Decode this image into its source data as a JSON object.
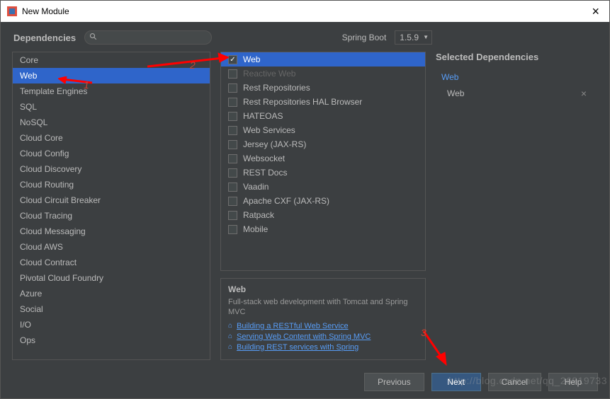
{
  "window": {
    "title": "New Module"
  },
  "header": {
    "dependencies_label": "Dependencies",
    "spring_boot_label": "Spring Boot",
    "version": "1.5.9"
  },
  "categories": [
    "Core",
    "Web",
    "Template Engines",
    "SQL",
    "NoSQL",
    "Cloud Core",
    "Cloud Config",
    "Cloud Discovery",
    "Cloud Routing",
    "Cloud Circuit Breaker",
    "Cloud Tracing",
    "Cloud Messaging",
    "Cloud AWS",
    "Cloud Contract",
    "Pivotal Cloud Foundry",
    "Azure",
    "Social",
    "I/O",
    "Ops"
  ],
  "categories_selected_index": 1,
  "dependencies": [
    {
      "label": "Web",
      "checked": true,
      "selected": true
    },
    {
      "label": "Reactive Web",
      "checked": false,
      "dim": true
    },
    {
      "label": "Rest Repositories",
      "checked": false
    },
    {
      "label": "Rest Repositories HAL Browser",
      "checked": false
    },
    {
      "label": "HATEOAS",
      "checked": false
    },
    {
      "label": "Web Services",
      "checked": false
    },
    {
      "label": "Jersey (JAX-RS)",
      "checked": false
    },
    {
      "label": "Websocket",
      "checked": false
    },
    {
      "label": "REST Docs",
      "checked": false
    },
    {
      "label": "Vaadin",
      "checked": false
    },
    {
      "label": "Apache CXF (JAX-RS)",
      "checked": false
    },
    {
      "label": "Ratpack",
      "checked": false
    },
    {
      "label": "Mobile",
      "checked": false
    }
  ],
  "detail": {
    "title": "Web",
    "description": "Full-stack web development with Tomcat and Spring MVC",
    "guides": [
      "Building a RESTful Web Service",
      "Serving Web Content with Spring MVC",
      "Building REST services with Spring"
    ]
  },
  "selected_panel": {
    "header": "Selected Dependencies",
    "groups": [
      {
        "category": "Web",
        "items": [
          "Web"
        ]
      }
    ]
  },
  "buttons": {
    "previous": "Previous",
    "next": "Next",
    "cancel": "Cancel",
    "help": "Help"
  },
  "annotations": {
    "a1": "1",
    "a2": "2",
    "a3": "3"
  },
  "watermark": "http://blog.csdn.net/qq_26819733"
}
